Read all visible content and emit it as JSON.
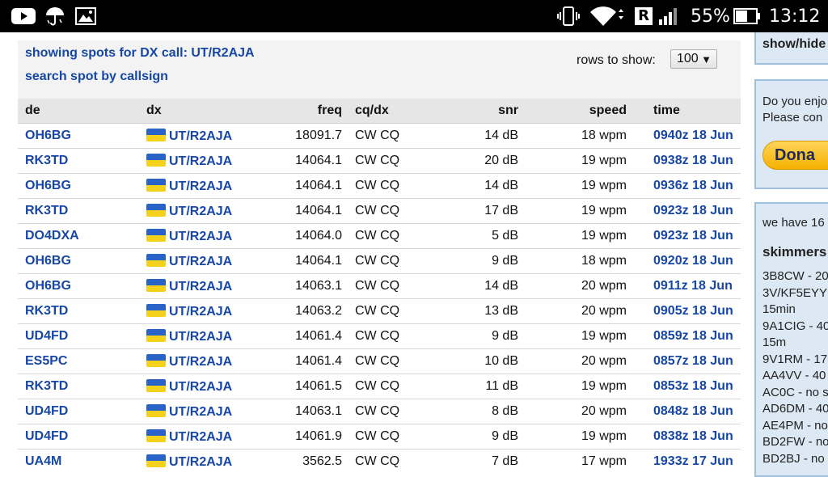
{
  "status_bar": {
    "battery_percent": "55%",
    "time": "13:12",
    "roaming_badge": "R",
    "icons": [
      "youtube-icon",
      "umbrella-icon",
      "image-icon",
      "vibrate-icon",
      "wifi-icon",
      "roaming-icon",
      "signal-icon",
      "battery-icon"
    ]
  },
  "header": {
    "showing_text": "showing spots for DX call: UT/R2AJA",
    "search_link": "search spot by callsign",
    "rows_label": "rows to show:",
    "rows_value": "100"
  },
  "table": {
    "columns": [
      "de",
      "dx",
      "freq",
      "cq/dx",
      "snr",
      "speed",
      "time"
    ],
    "rows": [
      {
        "de": "OH6BG",
        "dx": "UT/R2AJA",
        "freq": "18091.7",
        "cqdx": "CW CQ",
        "snr": "14 dB",
        "speed": "18 wpm",
        "time": "0940z 18 Jun"
      },
      {
        "de": "RK3TD",
        "dx": "UT/R2AJA",
        "freq": "14064.1",
        "cqdx": "CW CQ",
        "snr": "20 dB",
        "speed": "19 wpm",
        "time": "0938z 18 Jun"
      },
      {
        "de": "OH6BG",
        "dx": "UT/R2AJA",
        "freq": "14064.1",
        "cqdx": "CW CQ",
        "snr": "14 dB",
        "speed": "19 wpm",
        "time": "0936z 18 Jun"
      },
      {
        "de": "RK3TD",
        "dx": "UT/R2AJA",
        "freq": "14064.1",
        "cqdx": "CW CQ",
        "snr": "17 dB",
        "speed": "19 wpm",
        "time": "0923z 18 Jun"
      },
      {
        "de": "DO4DXA",
        "dx": "UT/R2AJA",
        "freq": "14064.0",
        "cqdx": "CW CQ",
        "snr": "5 dB",
        "speed": "19 wpm",
        "time": "0923z 18 Jun"
      },
      {
        "de": "OH6BG",
        "dx": "UT/R2AJA",
        "freq": "14064.1",
        "cqdx": "CW CQ",
        "snr": "9 dB",
        "speed": "18 wpm",
        "time": "0920z 18 Jun"
      },
      {
        "de": "OH6BG",
        "dx": "UT/R2AJA",
        "freq": "14063.1",
        "cqdx": "CW CQ",
        "snr": "14 dB",
        "speed": "20 wpm",
        "time": "0911z 18 Jun"
      },
      {
        "de": "RK3TD",
        "dx": "UT/R2AJA",
        "freq": "14063.2",
        "cqdx": "CW CQ",
        "snr": "13 dB",
        "speed": "20 wpm",
        "time": "0905z 18 Jun"
      },
      {
        "de": "UD4FD",
        "dx": "UT/R2AJA",
        "freq": "14061.4",
        "cqdx": "CW CQ",
        "snr": "9 dB",
        "speed": "19 wpm",
        "time": "0859z 18 Jun"
      },
      {
        "de": "ES5PC",
        "dx": "UT/R2AJA",
        "freq": "14061.4",
        "cqdx": "CW CQ",
        "snr": "10 dB",
        "speed": "20 wpm",
        "time": "0857z 18 Jun"
      },
      {
        "de": "RK3TD",
        "dx": "UT/R2AJA",
        "freq": "14061.5",
        "cqdx": "CW CQ",
        "snr": "11 dB",
        "speed": "19 wpm",
        "time": "0853z 18 Jun"
      },
      {
        "de": "UD4FD",
        "dx": "UT/R2AJA",
        "freq": "14063.1",
        "cqdx": "CW CQ",
        "snr": "8 dB",
        "speed": "20 wpm",
        "time": "0848z 18 Jun"
      },
      {
        "de": "UD4FD",
        "dx": "UT/R2AJA",
        "freq": "14061.9",
        "cqdx": "CW CQ",
        "snr": "9 dB",
        "speed": "19 wpm",
        "time": "0838z 18 Jun"
      },
      {
        "de": "UA4M",
        "dx": "UT/R2AJA",
        "freq": "3562.5",
        "cqdx": "CW CQ",
        "snr": "7 dB",
        "speed": "17 wpm",
        "time": "1933z 17 Jun"
      }
    ]
  },
  "sidebar": {
    "show_hide": "show/hide",
    "enjoy_line1": "Do you enjo",
    "enjoy_line2": "Please con",
    "donate_label": "Dona",
    "we_have": "we have 16",
    "skimmers_title": "skimmers",
    "skimmer_lines": [
      "3B8CW - 20",
      "3V/KF5EYY",
      "15min",
      "9A1CIG - 40",
      "15m",
      "9V1RM - 17",
      "AA4VV - 40",
      "AC0C - no s",
      "AD6DM - 40",
      "AE4PM - no",
      "BD2FW - no",
      "BD2BJ - no"
    ]
  },
  "colors": {
    "link": "#1747a6",
    "flag_blue": "#2a63c8",
    "flag_yellow": "#f4d21c",
    "sidebar_bg": "#dce8f3"
  }
}
